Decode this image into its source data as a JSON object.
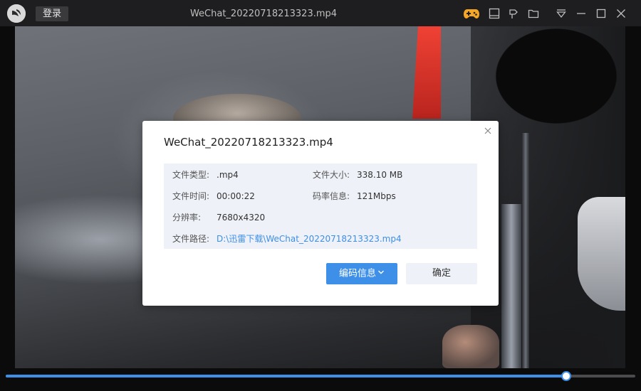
{
  "titlebar": {
    "login_label": "登录",
    "window_title": "WeChat_20220718213323.mp4",
    "icons": [
      "app-logo-icon",
      "gamepad-icon",
      "subtitle-icon",
      "pin-icon",
      "folder-icon",
      "menu-icon",
      "minimize-icon",
      "maximize-icon",
      "close-icon"
    ],
    "accent_icon_color": "#f5a623"
  },
  "dialog": {
    "title": "WeChat_20220718213323.mp4",
    "fields": {
      "file_type_label": "文件类型:",
      "file_type_value": ".mp4",
      "file_size_label": "文件大小:",
      "file_size_value": "338.10 MB",
      "duration_label": "文件时间:",
      "duration_value": "00:00:22",
      "bitrate_label": "码率信息:",
      "bitrate_value": "121Mbps",
      "resolution_label": "分辨率:",
      "resolution_value": "7680x4320",
      "path_label": "文件路径:",
      "path_value": "D:\\迅雷下载\\WeChat_20220718213323.mp4"
    },
    "encode_button_label": "编码信息",
    "ok_button_label": "确定"
  },
  "player": {
    "progress": 0.89
  },
  "colors": {
    "accent": "#3d8fe8",
    "titlebar_bg": "#1e1e20",
    "info_bg": "#eef1f7"
  }
}
